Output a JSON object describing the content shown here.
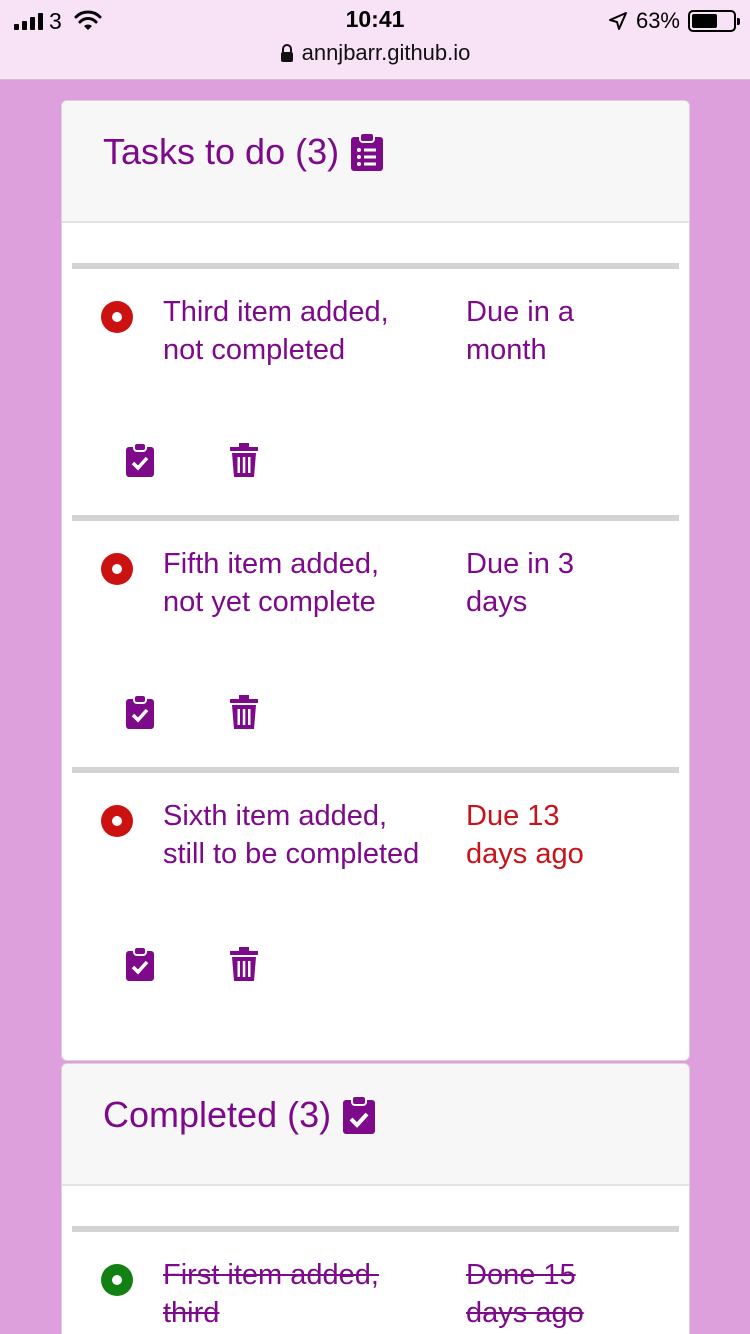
{
  "status_bar": {
    "carrier": "3",
    "time": "10:41",
    "url": "annjbarr.github.io",
    "battery": "63%",
    "battery_level": 0.63
  },
  "todo": {
    "title": "Tasks to do (3)",
    "icon": "clipboard-list-icon",
    "items": [
      {
        "text": "Third item added, not completed",
        "due": "Due in a month",
        "status_color": "#cc1111",
        "overdue": false
      },
      {
        "text": "Fifth item added, not yet complete",
        "due": "Due in 3 days",
        "status_color": "#cc1111",
        "overdue": false
      },
      {
        "text": "Sixth item added, still to be completed",
        "due": "Due 13 days ago",
        "status_color": "#cc1111",
        "overdue": true
      }
    ]
  },
  "completed": {
    "title": "Completed (3)",
    "icon": "clipboard-check-icon",
    "items": [
      {
        "text": "First item added, third",
        "due": "Done 15 days ago",
        "status_color": "#128012"
      }
    ]
  },
  "colors": {
    "accent": "#7d0a8a",
    "background": "#dea0dc",
    "overdue": "#c8131a",
    "done": "#128012"
  }
}
